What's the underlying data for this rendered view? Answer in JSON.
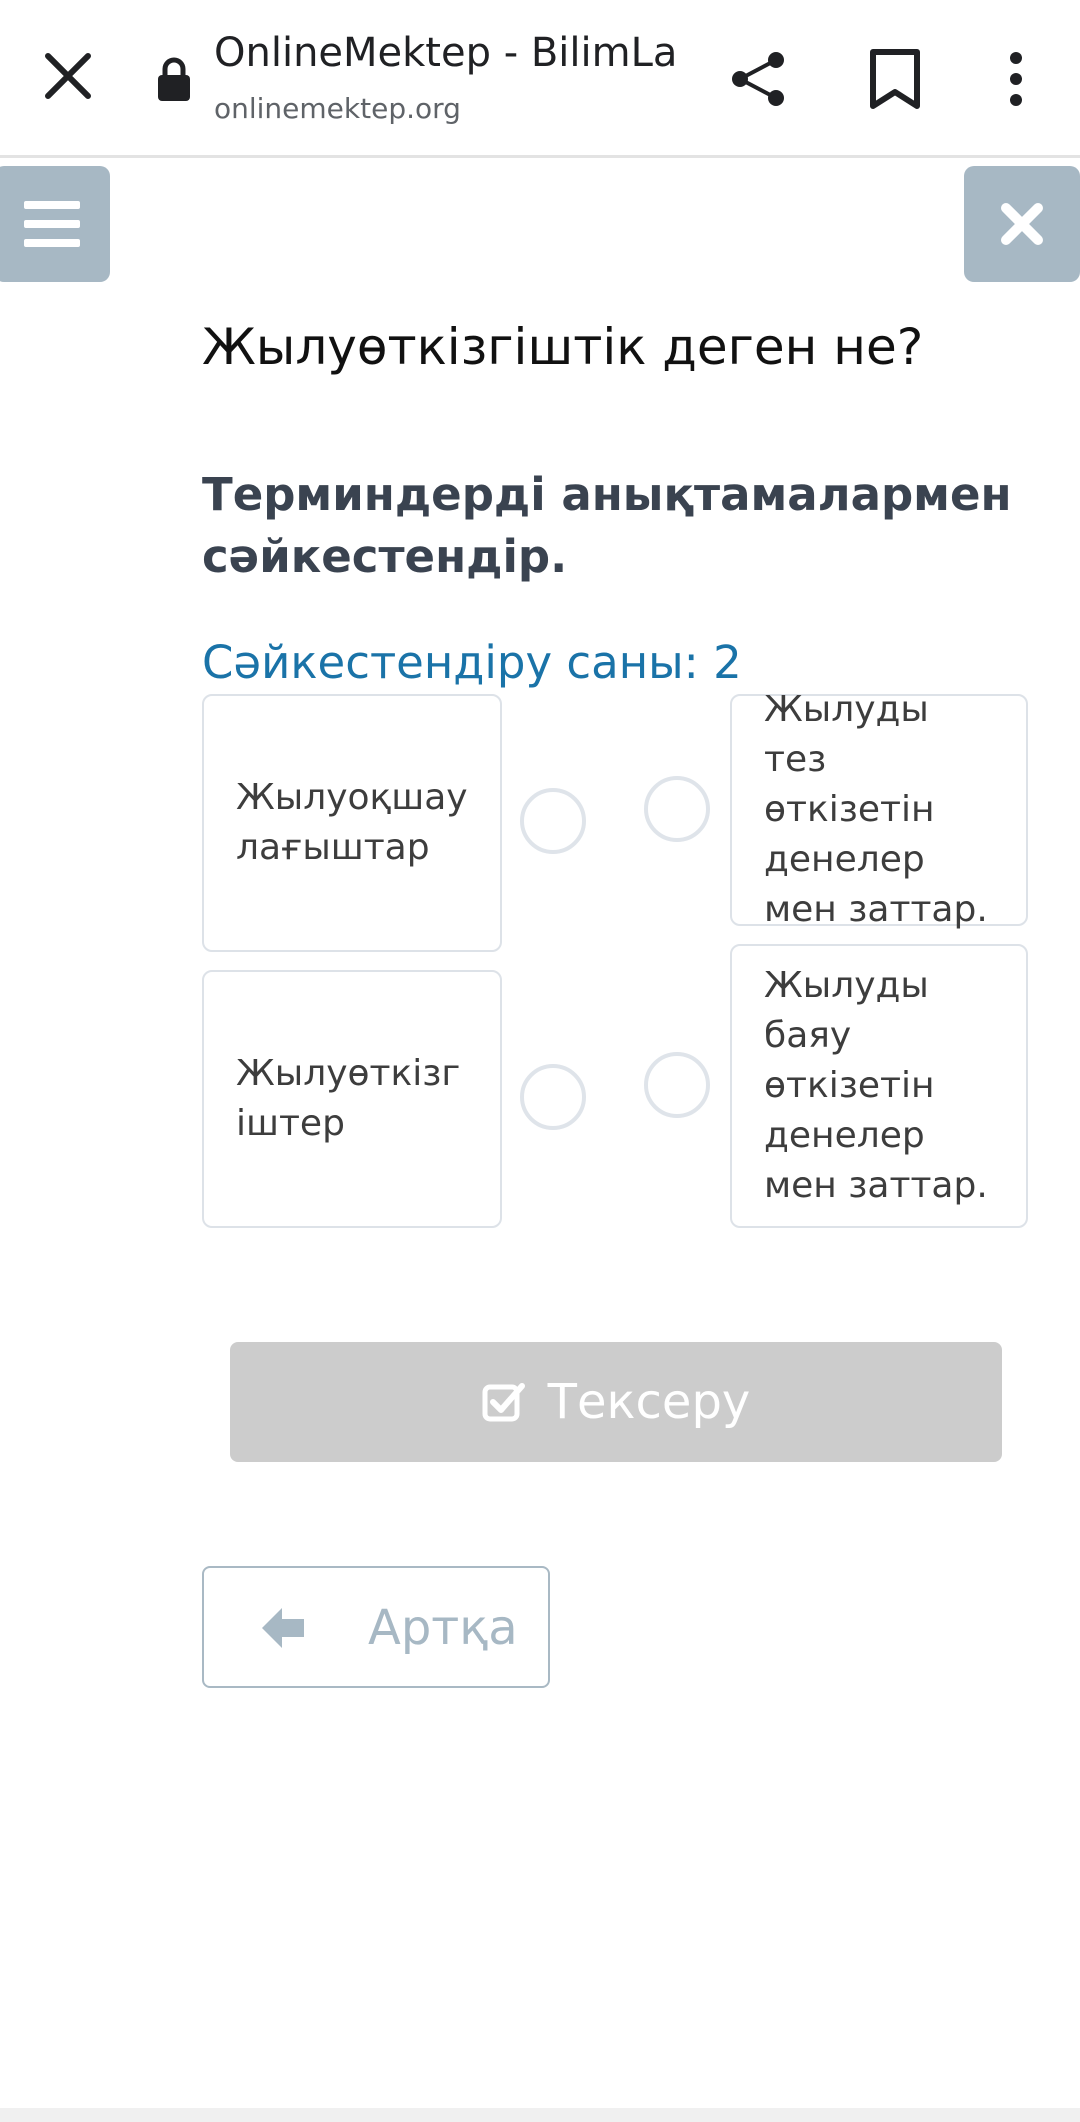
{
  "browser": {
    "title": "OnlineMektep - BilimLa…",
    "url": "onlinemektep.org",
    "icons": [
      "close-icon",
      "lock-icon",
      "share-icon",
      "bookmark-icon",
      "more-vert-icon"
    ]
  },
  "page": {
    "menu_icon": "menu-icon",
    "close_icon": "close-icon",
    "question_title": "Жылуөткізгіштік деген не?",
    "instruction": "Терминдерді анықтамалармен сәйкестендір.",
    "match_count_label": "Сәйкестендіру саны: 2",
    "terms": [
      {
        "label": "Жылуоқшаулағыштар"
      },
      {
        "label": "Жылуөткізгіштер"
      }
    ],
    "definitions": [
      {
        "label": "Жылуды тез өткізетін денелер мен заттар."
      },
      {
        "label": "Жылуды баяу өткізетін денелер мен заттар."
      }
    ],
    "check_button": "Тексеру",
    "back_button": "Артқа"
  },
  "colors": {
    "side_button": "#a7b8c4",
    "accent_blue": "#1a73a8",
    "disabled_button": "#cccccc"
  }
}
